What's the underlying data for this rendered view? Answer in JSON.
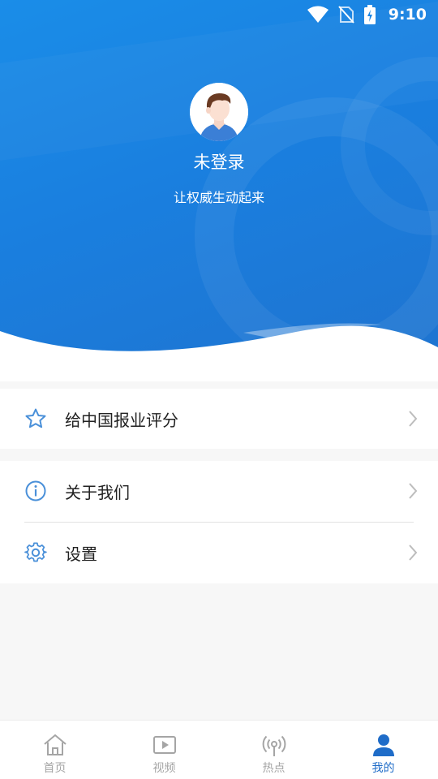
{
  "status_bar": {
    "time": "9:10"
  },
  "profile": {
    "username": "未登录",
    "slogan": "让权威生动起来"
  },
  "menu": {
    "group1": [
      {
        "label": "给中国报业评分",
        "icon": "star-icon"
      }
    ],
    "group2": [
      {
        "label": "关于我们",
        "icon": "info-icon"
      },
      {
        "label": "设置",
        "icon": "gear-icon"
      }
    ]
  },
  "tabbar": {
    "tabs": [
      {
        "label": "首页",
        "icon": "home-icon"
      },
      {
        "label": "视频",
        "icon": "video-icon"
      },
      {
        "label": "热点",
        "icon": "broadcast-icon"
      },
      {
        "label": "我的",
        "icon": "user-icon",
        "active": true
      }
    ]
  },
  "colors": {
    "header_blue": "#1a85e4",
    "accent": "#1f6cc8",
    "icon_blue": "#4a90d9",
    "inactive_gray": "#a5a5a5"
  }
}
